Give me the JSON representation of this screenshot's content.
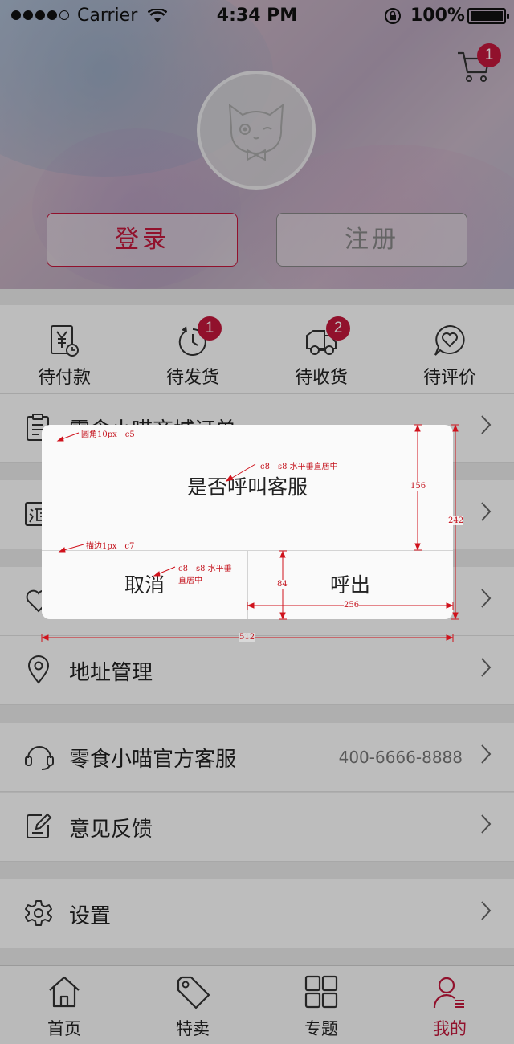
{
  "status_bar": {
    "carrier": "Carrier",
    "time": "4:34 PM",
    "battery": "100%"
  },
  "header": {
    "cart_badge": "1",
    "login_label": "登录",
    "register_label": "注册"
  },
  "orders": [
    {
      "label": "待付款",
      "icon": "payment-icon",
      "badge": ""
    },
    {
      "label": "待发货",
      "icon": "delivery-clock-icon",
      "badge": "1"
    },
    {
      "label": "待收货",
      "icon": "truck-icon",
      "badge": "2"
    },
    {
      "label": "待评价",
      "icon": "review-icon",
      "badge": ""
    }
  ],
  "menu": {
    "mall_orders": "零食小喵商城订单",
    "address": "地址管理",
    "service": "零食小喵官方客服",
    "service_phone": "400-6666-8888",
    "feedback": "意见反馈",
    "settings": "设置"
  },
  "dialog": {
    "message": "是否呼叫客服",
    "cancel": "取消",
    "call": "呼出"
  },
  "annotations": {
    "radius": "圆角10px　c5",
    "title_spec": "c8　s8 水平垂直居中",
    "border": "描边1px　c7",
    "btn_spec_1": "c8　s8 水平垂",
    "btn_spec_2": "直居中",
    "h156": "156",
    "h242": "242",
    "h84": "84",
    "w256": "256",
    "w512": "512"
  },
  "tabs": [
    {
      "label": "首页",
      "icon": "home-icon",
      "active": false
    },
    {
      "label": "特卖",
      "icon": "tag-icon",
      "active": false
    },
    {
      "label": "专题",
      "icon": "grid-icon",
      "active": false
    },
    {
      "label": "我的",
      "icon": "user-icon",
      "active": true
    }
  ],
  "colors": {
    "accent": "#c4183c",
    "annotation": "#c4121c"
  }
}
